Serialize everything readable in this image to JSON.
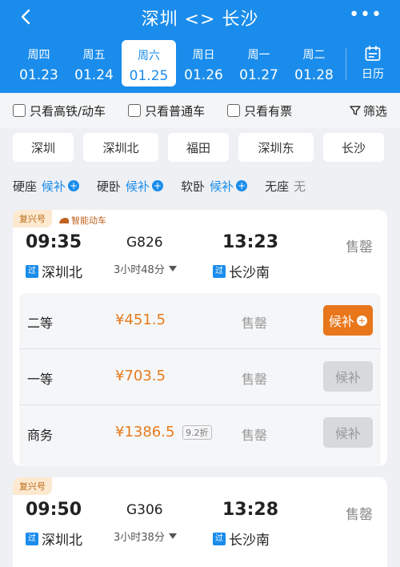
{
  "header": {
    "title": "深圳 <> 长沙",
    "more": "•••",
    "dates": [
      {
        "weekday": "周四",
        "date": "01.23"
      },
      {
        "weekday": "周五",
        "date": "01.24"
      },
      {
        "weekday": "周六",
        "date": "01.25"
      },
      {
        "weekday": "周日",
        "date": "01.26"
      },
      {
        "weekday": "周一",
        "date": "01.27"
      },
      {
        "weekday": "周二",
        "date": "01.28"
      }
    ],
    "calendar_label": "日历"
  },
  "filters": {
    "high_speed": "只看高铁/动车",
    "normal": "只看普通车",
    "available": "只看有票",
    "sort": "筛选"
  },
  "stations": [
    "深圳",
    "深圳北",
    "福田",
    "深圳东",
    "长沙"
  ],
  "seat_filters": [
    {
      "label": "硬座",
      "value": "候补",
      "plus": "+"
    },
    {
      "label": "硬卧",
      "value": "候补",
      "plus": "+"
    },
    {
      "label": "软卧",
      "value": "候补",
      "plus": "+"
    },
    {
      "label": "无座",
      "value": "无"
    }
  ],
  "trains": [
    {
      "tag1": "复兴号",
      "tag2": "智能动车",
      "dep_time": "09:35",
      "arr_time": "13:23",
      "train_no": "G826",
      "duration": "3小时48分",
      "dep_station": "深圳北",
      "arr_station": "长沙南",
      "guo": "过",
      "status": "售罄",
      "seats": [
        {
          "name": "二等",
          "price": "¥451.5",
          "status": "售罄",
          "btn": "候补",
          "btn_plus": "+"
        },
        {
          "name": "一等",
          "price": "¥703.5",
          "status": "售罄",
          "btn": "候补"
        },
        {
          "name": "商务",
          "price": "¥1386.5",
          "discount": "9.2折",
          "status": "售罄",
          "btn": "候补"
        }
      ]
    },
    {
      "tag1": "复兴号",
      "dep_time": "09:50",
      "arr_time": "13:28",
      "train_no": "G306",
      "duration": "3小时38分",
      "dep_station": "深圳北",
      "arr_station": "长沙南",
      "guo": "过",
      "status": "售罄"
    }
  ],
  "colors": {
    "brand": "#1a8ceb",
    "accent": "#e8761a",
    "price": "#e87b1c"
  }
}
